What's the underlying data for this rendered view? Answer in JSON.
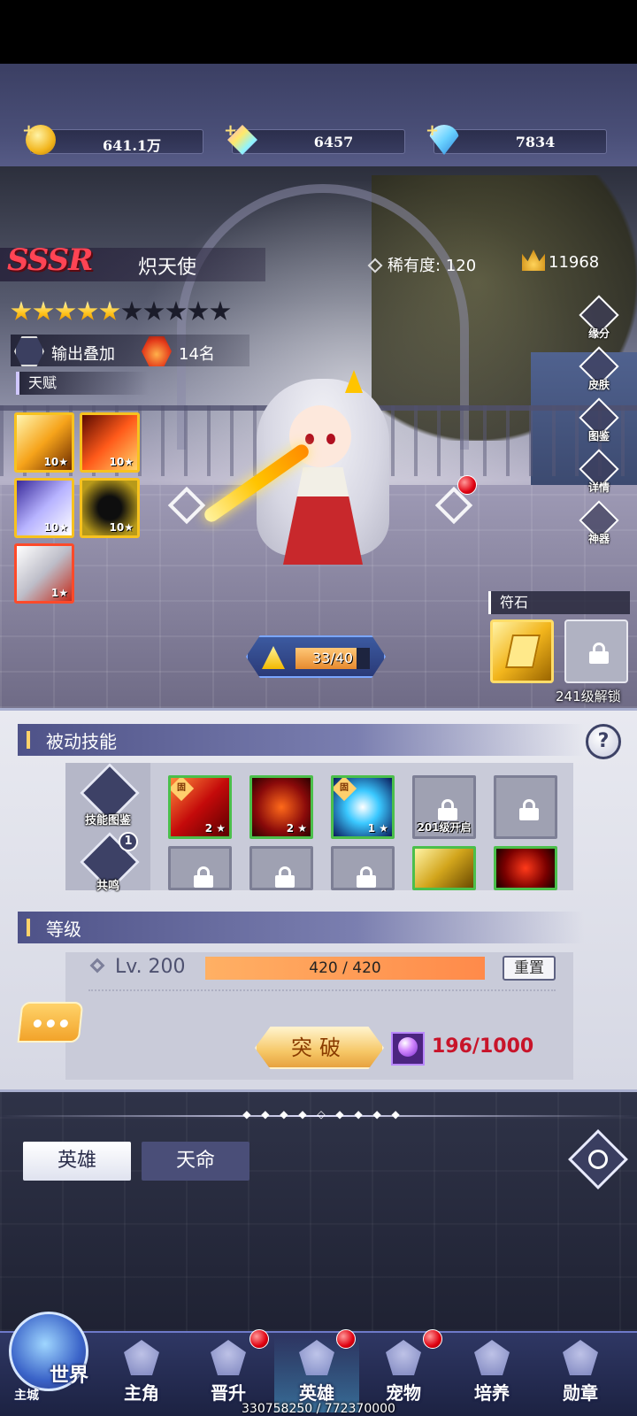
{
  "currency": {
    "gold": "641.1万",
    "crystal": "6457",
    "diamond": "7834"
  },
  "hero": {
    "grade": "SSSR",
    "name": "炽天使",
    "rarity_label": "稀有度:",
    "rarity_value": "120",
    "power": "11968",
    "stars_lit": 5,
    "stars_total": 10,
    "tag_output": "输出叠加",
    "tag_rank": "14名",
    "talent_label": "天赋",
    "talents": [
      {
        "level": "10"
      },
      {
        "level": "10"
      },
      {
        "level": "10"
      },
      {
        "level": "10"
      },
      {
        "level": "1"
      }
    ],
    "level_progress": "33/40",
    "level_progress_fraction": 0.825
  },
  "side_buttons": [
    "缘分",
    "皮肤",
    "图鉴",
    "详情",
    "神器"
  ],
  "rune": {
    "label": "符石",
    "locked_text": "241级解锁"
  },
  "passive": {
    "title": "被动技能",
    "help": "?",
    "skill_book": "技能图鉴",
    "resonance": "共鸣",
    "resonance_badge": "1",
    "fixed_tag": "固",
    "skills_row1": [
      {
        "level": "2",
        "fixed": true
      },
      {
        "level": "2",
        "fixed": false
      },
      {
        "level": "1",
        "fixed": true
      },
      {
        "caption": "201级开启"
      },
      {
        "caption": ""
      }
    ]
  },
  "level": {
    "title": "等级",
    "lv": "Lv. 200",
    "exp": "420 / 420",
    "exp_fraction": 1.0,
    "reset": "重置",
    "breakthrough": "突破",
    "material": "196/1000"
  },
  "tabs": {
    "hero": "英雄",
    "fate": "天命"
  },
  "nav": {
    "world": "世界",
    "world_sub": "主城",
    "items": [
      "主角",
      "晋升",
      "英雄",
      "宠物",
      "培养",
      "勋章"
    ]
  },
  "footer": "330758250 / 772370000",
  "colors": {
    "accent_red": "#c8142a",
    "exp_orange": "#ff8a4a",
    "skill_border": "#4bbf4b"
  }
}
